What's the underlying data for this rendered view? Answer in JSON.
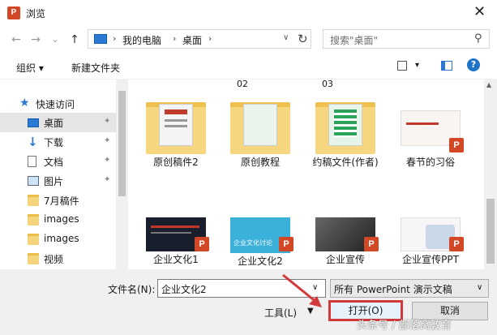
{
  "window": {
    "title": "浏览",
    "app_icon": "P",
    "close": "✕"
  },
  "nav": {
    "back": "←",
    "forward": "→",
    "dropdown": "⌄",
    "up": "↑"
  },
  "address": {
    "sep": "›",
    "crumbs": [
      "我的电脑",
      "桌面"
    ],
    "dropdown": "∨",
    "refresh": "↻"
  },
  "search": {
    "placeholder": "搜索\"桌面\"",
    "icon": "⚲"
  },
  "toolbar": {
    "organize": "组织 ▾",
    "new_folder": "新建文件夹",
    "view_drop": "▾",
    "help": "?"
  },
  "sidebar": {
    "items": [
      {
        "label": "快速访问",
        "icon": "star-icon"
      },
      {
        "label": "桌面",
        "icon": "desktop-icon",
        "pin": "📌"
      },
      {
        "label": "下载",
        "icon": "download-icon",
        "pin": "📌"
      },
      {
        "label": "文档",
        "icon": "document-icon",
        "pin": "📌"
      },
      {
        "label": "图片",
        "icon": "picture-icon",
        "pin": "📌"
      },
      {
        "label": "7月稿件",
        "icon": "folder-icon"
      },
      {
        "label": "images",
        "icon": "folder-icon"
      },
      {
        "label": "images",
        "icon": "folder-icon"
      },
      {
        "label": "视频",
        "icon": "folder-icon"
      }
    ]
  },
  "files": {
    "labels_top": [
      "02",
      "03"
    ],
    "row1": [
      "原创稿件2",
      "原创教程",
      "约稿文件(作者)",
      "春节的习俗"
    ],
    "row2": [
      "企业文化1",
      "企业文化2",
      "企业宣传",
      "企业宣传PPT"
    ],
    "thumb_caption": "企业文化讨论",
    "ppt_badge": "P"
  },
  "bottom": {
    "filename_label": "文件名(N):",
    "filename_value": "企业文化2",
    "filetype_value": "所有 PowerPoint 演示文稿",
    "tools": "工具(L)",
    "open": "打开(O)",
    "cancel": "取消",
    "dropdown": "∨",
    "tools_drop": "▼"
  },
  "watermark": "头条号 / 部落窝教育",
  "colors": {
    "accent": "#d23a3a",
    "selection": "#cce8ff",
    "ppt": "#d24726",
    "folder": "#f6d77f"
  }
}
